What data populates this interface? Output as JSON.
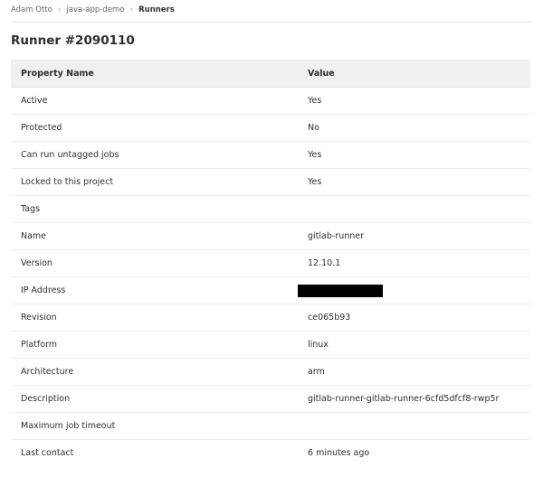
{
  "breadcrumb": {
    "items": [
      "Adam Otto",
      "java-app-demo",
      "Runners"
    ],
    "separator": "›"
  },
  "page": {
    "title": "Runner #2090110"
  },
  "table": {
    "headers": [
      "Property Name",
      "Value"
    ],
    "rows": [
      {
        "property": "Active",
        "value": "Yes"
      },
      {
        "property": "Protected",
        "value": "No"
      },
      {
        "property": "Can run untagged jobs",
        "value": "Yes"
      },
      {
        "property": "Locked to this project",
        "value": "Yes"
      },
      {
        "property": "Tags",
        "value": ""
      },
      {
        "property": "Name",
        "value": "gitlab-runner"
      },
      {
        "property": "Version",
        "value": "12.10.1"
      },
      {
        "property": "IP Address",
        "value": ""
      },
      {
        "property": "Revision",
        "value": "ce065b93"
      },
      {
        "property": "Platform",
        "value": "linux"
      },
      {
        "property": "Architecture",
        "value": "arm"
      },
      {
        "property": "Description",
        "value": "gitlab-runner-gitlab-runner-6cfd5dfcf8-rwp5r"
      },
      {
        "property": "Maximum job timeout",
        "value": ""
      },
      {
        "property": "Last contact",
        "value": "6 minutes ago"
      }
    ]
  },
  "colors": {
    "header_bg": "#f0f0f0",
    "text": "#2e2e2e",
    "muted_text": "#666666",
    "border": "#ededed",
    "redaction": "#000000"
  }
}
